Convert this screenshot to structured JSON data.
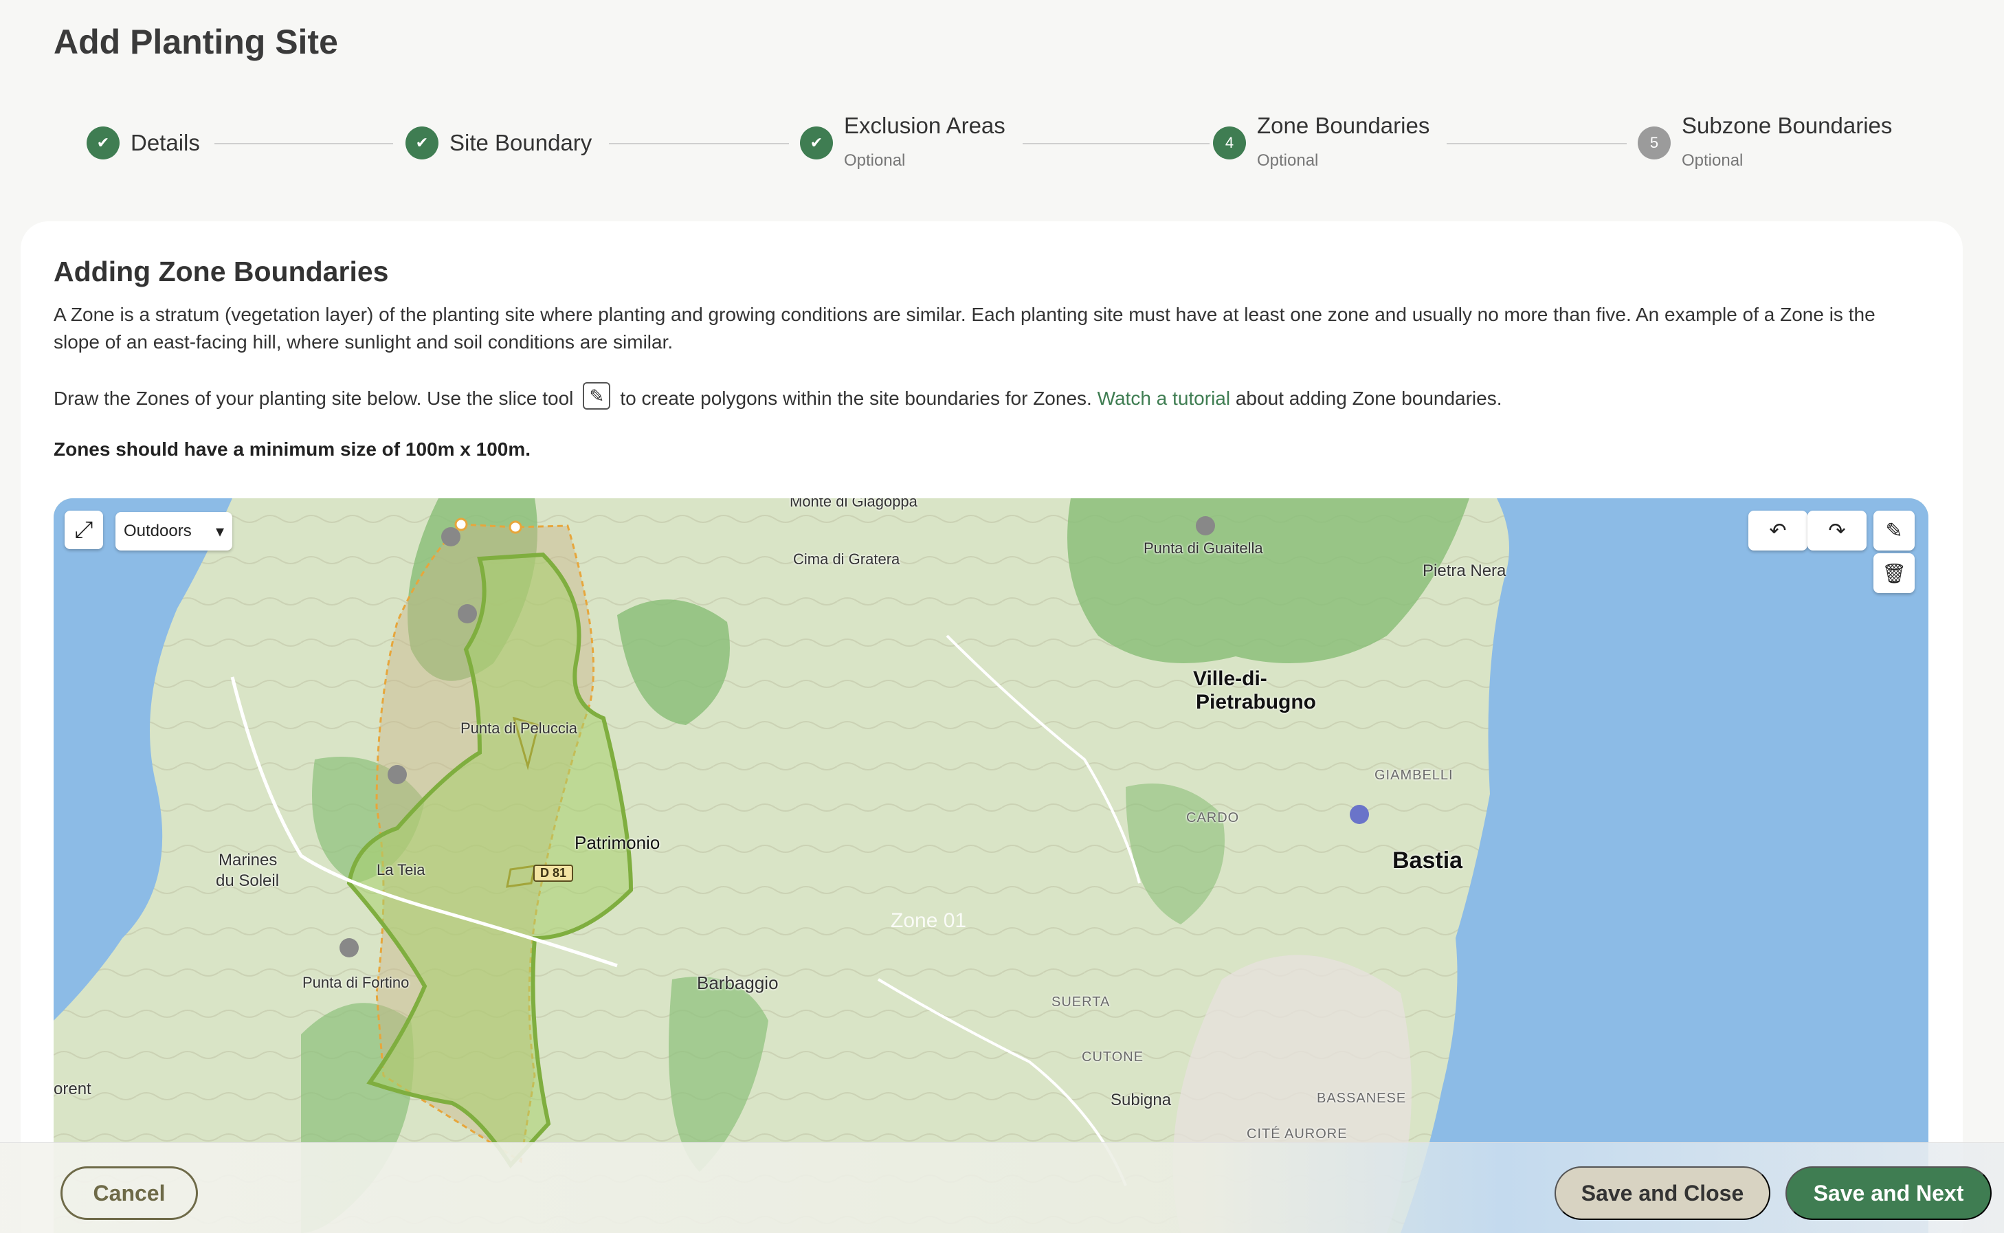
{
  "page": {
    "title": "Add Planting Site"
  },
  "stepper": {
    "steps": [
      {
        "label": "Details",
        "status": "done"
      },
      {
        "label": "Site Boundary",
        "status": "done"
      },
      {
        "label": "Exclusion Areas",
        "sub": "Optional",
        "status": "done"
      },
      {
        "label": "Zone Boundaries",
        "sub": "Optional",
        "number": "4",
        "status": "current"
      },
      {
        "label": "Subzone Boundaries",
        "sub": "Optional",
        "number": "5",
        "status": "future"
      }
    ]
  },
  "content": {
    "title": "Adding Zone Boundaries",
    "p1": "A Zone is a stratum (vegetation layer) of the planting site where planting and growing conditions are similar. Each planting site must have at least one zone and usually no more than five. An example of a Zone is the slope of an east-facing hill, where sunlight and soil conditions are similar.",
    "p2_before": "Draw the Zones of your planting site below. Use the slice tool",
    "p2_after": "to create polygons within the site boundaries for Zones.",
    "p2_link": "Watch a tutorial",
    "p2_end": "about adding Zone boundaries.",
    "note": "Zones should have a minimum size of 100m x 100m."
  },
  "map": {
    "style_select": "Outdoors",
    "zone_label": "Zone 01",
    "labels": {
      "monte": "Monte di Giagoppa",
      "cima": "Cima di Gratera",
      "guaitella": "Punta di Guaitella",
      "pietra": "Pietra Nera",
      "ville1": "Ville-di-",
      "ville2": "Pietrabugno",
      "peluccia": "Punta di Peluccia",
      "giambelli": "GIAMBELLI",
      "cardo": "CARDO",
      "bastia": "Bastia",
      "patrimonio": "Patrimonio",
      "d81": "D 81",
      "marines1": "Marines",
      "marines2": "du Soleil",
      "lateia": "La Teia",
      "fortino": "Punta di Fortino",
      "barbaggio": "Barbaggio",
      "suerta": "SUERTA",
      "cutone": "CUTONE",
      "subigna": "Subigna",
      "bassanese": "BASSANESE",
      "cite": "CITÉ AURORE",
      "orent": "orent"
    },
    "colors": {
      "sea": "#8cbbe6",
      "land": "#d9e4c6",
      "forest": "#8cc07a",
      "zone": "#7fae3f"
    }
  },
  "footer": {
    "cancel": "Cancel",
    "save_close": "Save and Close",
    "save_next": "Save and Next"
  }
}
